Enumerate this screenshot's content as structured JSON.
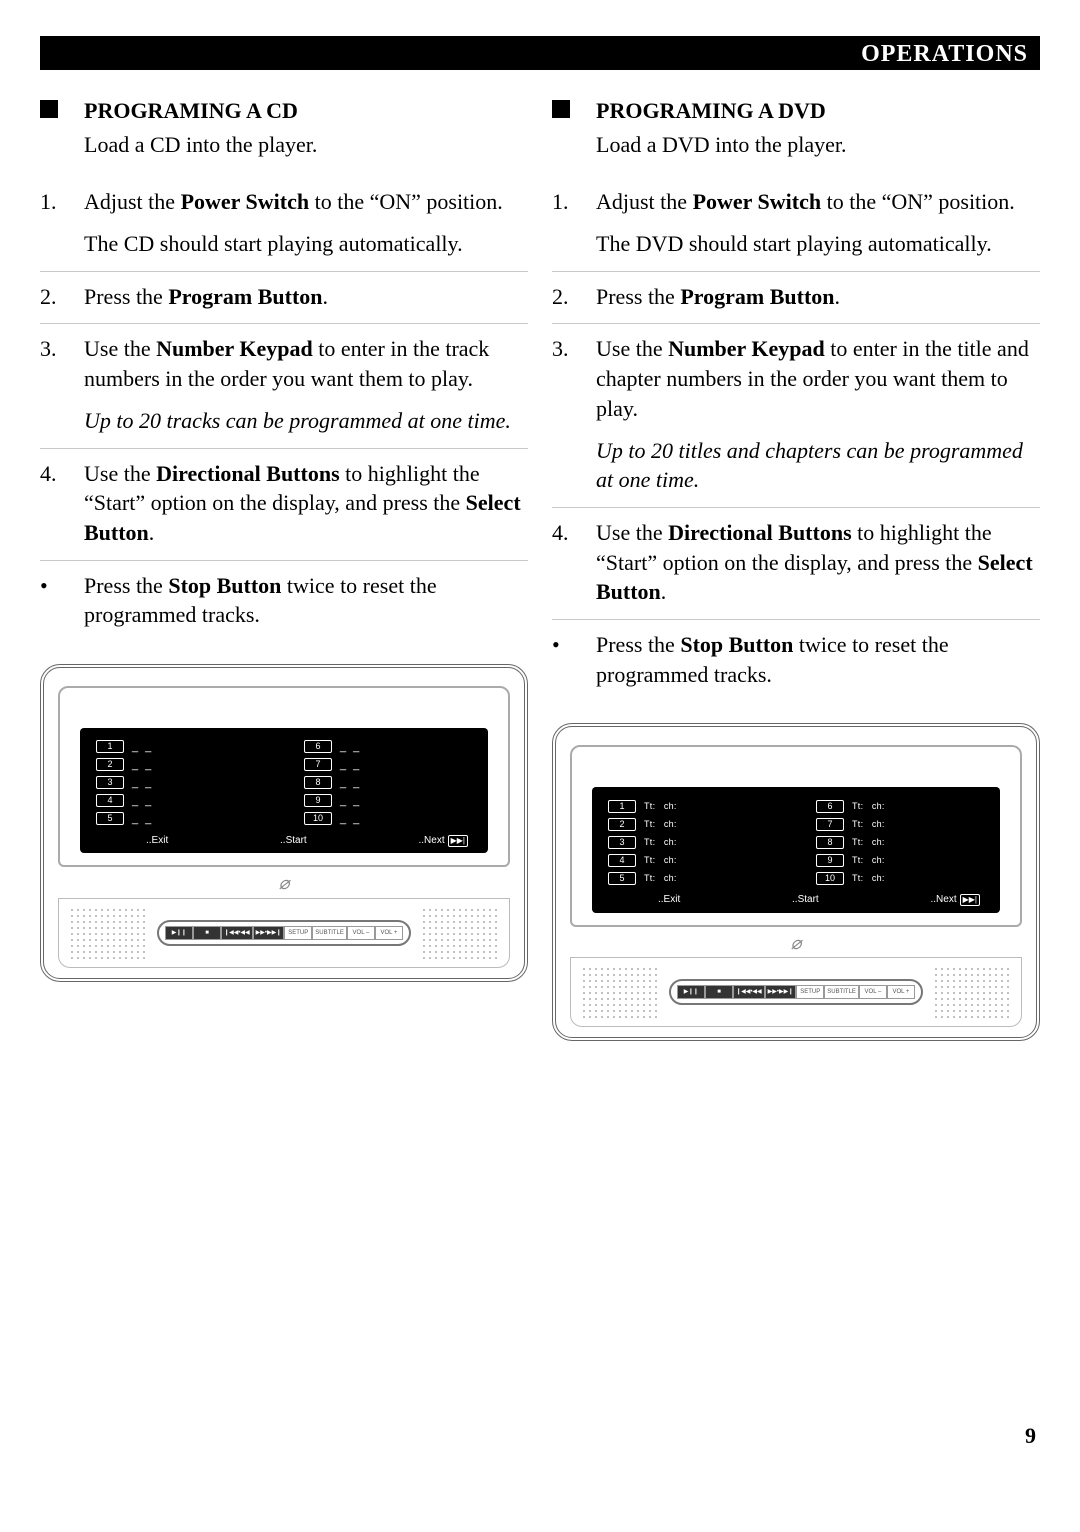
{
  "header": {
    "title": "OPERATIONS"
  },
  "page_number": "9",
  "cd": {
    "heading": "PROGRAMING A CD",
    "lead": "Load a CD into the player.",
    "steps": [
      {
        "num": "1.",
        "text_pre": "Adjust the ",
        "text_bold1": "Power Switch",
        "text_mid": " to the “ON” position.",
        "sub": "The CD should start playing automatically."
      },
      {
        "num": "2.",
        "text_pre": "Press the ",
        "text_bold1": "Program Button",
        "text_mid": "."
      },
      {
        "num": "3.",
        "text_pre": "Use the ",
        "text_bold1": "Number Keypad",
        "text_mid": " to enter in the track numbers in the order you want them to play.",
        "sub_italic": "Up to 20 tracks can be programmed at one time."
      },
      {
        "num": "4.",
        "text_pre": "Use the ",
        "text_bold1": "Directional Buttons",
        "text_mid": " to highlight the “Start” option on the display, and press the ",
        "text_bold2": "Select Button",
        "text_end": "."
      }
    ],
    "bullet": {
      "text_pre": "Press the ",
      "text_bold1": "Stop Button",
      "text_mid": " twice to reset the programmed tracks."
    },
    "screen": {
      "left_nums": [
        "1",
        "2",
        "3",
        "4",
        "5"
      ],
      "right_nums": [
        "6",
        "7",
        "8",
        "9",
        "10"
      ],
      "row_label": "",
      "dash": "_ _",
      "exit": "..Exit",
      "start": "..Start",
      "next": "..Next"
    }
  },
  "dvd": {
    "heading": "PROGRAMING A DVD",
    "lead": "Load a DVD into the player.",
    "steps": [
      {
        "num": "1.",
        "text_pre": "Adjust the ",
        "text_bold1": "Power Switch",
        "text_mid": " to the “ON” position.",
        "sub": "The DVD should start playing automatically."
      },
      {
        "num": "2.",
        "text_pre": "Press the ",
        "text_bold1": "Program Button",
        "text_mid": "."
      },
      {
        "num": "3.",
        "text_pre": "Use the ",
        "text_bold1": "Number Keypad",
        "text_mid": " to enter in the title and chapter numbers in the order you want them to play.",
        "sub_italic": "Up to 20 titles and chapters can be programmed at one time."
      },
      {
        "num": "4.",
        "text_pre": "Use the ",
        "text_bold1": "Directional Buttons",
        "text_mid": " to highlight the “Start” option on the display, and press the ",
        "text_bold2": "Select Button",
        "text_end": "."
      }
    ],
    "bullet": {
      "text_pre": "Press the ",
      "text_bold1": "Stop Button",
      "text_mid": " twice to reset the programmed tracks."
    },
    "screen": {
      "left_nums": [
        "1",
        "2",
        "3",
        "4",
        "5"
      ],
      "right_nums": [
        "6",
        "7",
        "8",
        "9",
        "10"
      ],
      "row_label_tt": "Tt:",
      "row_label_ch": "ch:",
      "exit": "..Exit",
      "start": "..Start",
      "next": "..Next"
    }
  },
  "controls": {
    "buttons": [
      "▶❙❙",
      "■",
      "❙◀◀•◀◀",
      "▶▶•▶▶❙",
      "SETUP",
      "SUBTITLE",
      "VOL –",
      "VOL +"
    ]
  }
}
